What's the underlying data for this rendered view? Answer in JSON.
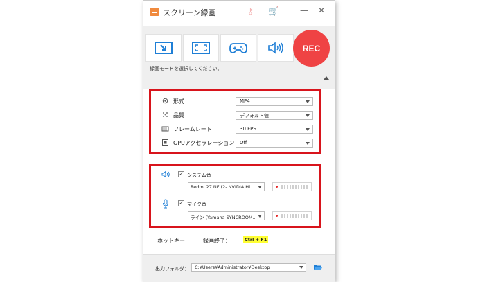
{
  "window": {
    "title": "スクリーン録画"
  },
  "toolbar": {
    "modes": [
      {
        "icon": "region-select-icon"
      },
      {
        "icon": "fullscreen-icon"
      },
      {
        "icon": "gamepad-icon"
      },
      {
        "icon": "audio-only-icon"
      }
    ],
    "rec_label": "REC",
    "hint": "録画モードを選択してください。"
  },
  "settings": {
    "format": {
      "label": "形式",
      "value": "MP4"
    },
    "quality": {
      "label": "品質",
      "value": "デフォルト値"
    },
    "framerate": {
      "label": "フレームレート",
      "value": "30 FPS"
    },
    "gpu": {
      "label": "GPUアクセラレーション",
      "value": "Off"
    }
  },
  "audio": {
    "system": {
      "label": "システム音",
      "device": "Redmi 27 NF (2- NVIDIA Hi...",
      "checked": true
    },
    "mic": {
      "label": "マイク音",
      "device": "ライン (Yamaha SYNCROOM...",
      "checked": true
    }
  },
  "hotkeys": {
    "label": "ホットキー",
    "stop_label": "録画終了：",
    "stop_key": "Ctrl + F1"
  },
  "output": {
    "label": "出力フォルダ：",
    "path": "C:¥Users¥Administrator¥Desktop"
  },
  "colors": {
    "accent": "#ef4344",
    "highlight_box": "#d8141c",
    "icon_blue": "#1f7fd6"
  }
}
